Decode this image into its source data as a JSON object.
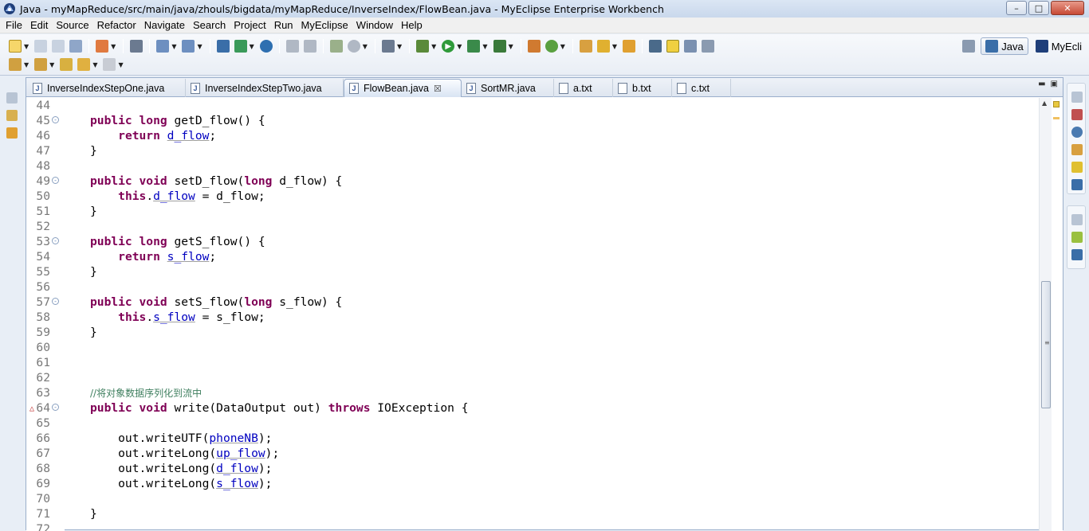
{
  "window": {
    "title": "Java - myMapReduce/src/main/java/zhouls/bigdata/myMapReduce/InverseIndex/FlowBean.java - MyEclipse Enterprise Workbench",
    "minimize": "–",
    "maximize": "□",
    "close": "✕"
  },
  "menu": [
    "File",
    "Edit",
    "Source",
    "Refactor",
    "Navigate",
    "Search",
    "Project",
    "Run",
    "MyEclipse",
    "Window",
    "Help"
  ],
  "perspectives": {
    "java": "Java",
    "myeclipse": "MyEcli"
  },
  "tabs": [
    "InverseIndexStepOne.java",
    "InverseIndexStepTwo.java",
    "FlowBean.java",
    "SortMR.java",
    "a.txt",
    "b.txt",
    "c.txt"
  ],
  "active_tab_close": "☒",
  "code": {
    "lines": [
      {
        "n": "44",
        "tokens": []
      },
      {
        "n": "45",
        "fold": "⊖",
        "tokens": [
          [
            "kw",
            "public"
          ],
          [
            "t",
            " "
          ],
          [
            "kw",
            "long"
          ],
          [
            "t",
            " getD_flow() {"
          ]
        ]
      },
      {
        "n": "46",
        "tokens": [
          [
            "t",
            "    "
          ],
          [
            "kw",
            "return"
          ],
          [
            "t",
            " "
          ],
          [
            "fld",
            "d_flow"
          ],
          [
            "t",
            ";"
          ]
        ]
      },
      {
        "n": "47",
        "tokens": [
          [
            "t",
            "}"
          ]
        ]
      },
      {
        "n": "48",
        "tokens": []
      },
      {
        "n": "49",
        "fold": "⊖",
        "tokens": [
          [
            "kw",
            "public"
          ],
          [
            "t",
            " "
          ],
          [
            "kw",
            "void"
          ],
          [
            "t",
            " setD_flow("
          ],
          [
            "kw",
            "long"
          ],
          [
            "t",
            " d_flow) {"
          ]
        ]
      },
      {
        "n": "50",
        "tokens": [
          [
            "t",
            "    "
          ],
          [
            "kw",
            "this"
          ],
          [
            "t",
            "."
          ],
          [
            "fld",
            "d_flow"
          ],
          [
            "t",
            " = d_flow;"
          ]
        ]
      },
      {
        "n": "51",
        "tokens": [
          [
            "t",
            "}"
          ]
        ]
      },
      {
        "n": "52",
        "tokens": []
      },
      {
        "n": "53",
        "fold": "⊖",
        "tokens": [
          [
            "kw",
            "public"
          ],
          [
            "t",
            " "
          ],
          [
            "kw",
            "long"
          ],
          [
            "t",
            " getS_flow() {"
          ]
        ]
      },
      {
        "n": "54",
        "tokens": [
          [
            "t",
            "    "
          ],
          [
            "kw",
            "return"
          ],
          [
            "t",
            " "
          ],
          [
            "fld",
            "s_flow"
          ],
          [
            "t",
            ";"
          ]
        ]
      },
      {
        "n": "55",
        "tokens": [
          [
            "t",
            "}"
          ]
        ]
      },
      {
        "n": "56",
        "tokens": []
      },
      {
        "n": "57",
        "fold": "⊖",
        "tokens": [
          [
            "kw",
            "public"
          ],
          [
            "t",
            " "
          ],
          [
            "kw",
            "void"
          ],
          [
            "t",
            " setS_flow("
          ],
          [
            "kw",
            "long"
          ],
          [
            "t",
            " s_flow) {"
          ]
        ]
      },
      {
        "n": "58",
        "tokens": [
          [
            "t",
            "    "
          ],
          [
            "kw",
            "this"
          ],
          [
            "t",
            "."
          ],
          [
            "fld",
            "s_flow"
          ],
          [
            "t",
            " = s_flow;"
          ]
        ]
      },
      {
        "n": "59",
        "tokens": [
          [
            "t",
            "}"
          ]
        ]
      },
      {
        "n": "60",
        "tokens": []
      },
      {
        "n": "61",
        "tokens": []
      },
      {
        "n": "62",
        "tokens": []
      },
      {
        "n": "63",
        "tokens": [
          [
            "cmt",
            "//将对象数据序列化到流中"
          ]
        ]
      },
      {
        "n": "64",
        "fold": "⊖",
        "override": "△",
        "tokens": [
          [
            "kw",
            "public"
          ],
          [
            "t",
            " "
          ],
          [
            "kw",
            "void"
          ],
          [
            "t",
            " write(DataOutput out) "
          ],
          [
            "kw",
            "throws"
          ],
          [
            "t",
            " IOException {"
          ]
        ]
      },
      {
        "n": "65",
        "tokens": []
      },
      {
        "n": "66",
        "tokens": [
          [
            "t",
            "    out.writeUTF("
          ],
          [
            "fld",
            "phoneNB"
          ],
          [
            "t",
            ");"
          ]
        ]
      },
      {
        "n": "67",
        "tokens": [
          [
            "t",
            "    out.writeLong("
          ],
          [
            "fld",
            "up_flow"
          ],
          [
            "t",
            ");"
          ]
        ]
      },
      {
        "n": "68",
        "tokens": [
          [
            "t",
            "    out.writeLong("
          ],
          [
            "fld",
            "d_flow"
          ],
          [
            "t",
            ");"
          ]
        ]
      },
      {
        "n": "69",
        "tokens": [
          [
            "t",
            "    out.writeLong("
          ],
          [
            "fld",
            "s_flow"
          ],
          [
            "t",
            ");"
          ]
        ]
      },
      {
        "n": "70",
        "tokens": []
      },
      {
        "n": "71",
        "tokens": [
          [
            "t",
            "}"
          ]
        ]
      },
      {
        "n": "72",
        "tokens": []
      }
    ]
  },
  "colors": {
    "keyword": "#7f0055",
    "field": "#0000c0",
    "comment": "#3f7f5f",
    "line_number": "#787878"
  },
  "icons": {
    "app": "myeclipse-icon",
    "left_strip": [
      "restore-icon",
      "package-explorer-icon",
      "hierarchy-icon"
    ],
    "right_strip_top": [
      "restore-icon",
      "problems-icon",
      "javadoc-icon",
      "declaration-icon",
      "servers-icon",
      "console-icon"
    ],
    "right_strip_bottom": [
      "restore-icon",
      "outline-icon",
      "tasks-icon"
    ]
  }
}
